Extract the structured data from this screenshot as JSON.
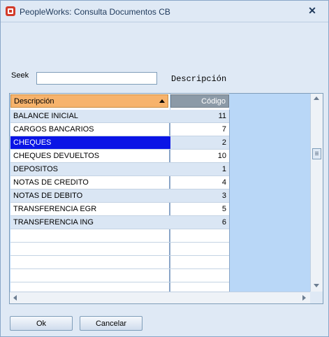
{
  "window": {
    "title": "PeopleWorks: Consulta Documentos CB",
    "close_glyph": "✕"
  },
  "seek": {
    "label": "Seek",
    "value": "",
    "field_caption": "Descripción"
  },
  "grid": {
    "columns": {
      "description": "Descripción",
      "code": "Código"
    },
    "rows": [
      {
        "description": "BALANCE INICIAL",
        "code": "11"
      },
      {
        "description": "CARGOS BANCARIOS",
        "code": "7"
      },
      {
        "description": "CHEQUES",
        "code": "2"
      },
      {
        "description": "CHEQUES DEVUELTOS",
        "code": "10"
      },
      {
        "description": "DEPOSITOS",
        "code": "1"
      },
      {
        "description": "NOTAS DE CREDITO",
        "code": "4"
      },
      {
        "description": "NOTAS DE DEBITO",
        "code": "3"
      },
      {
        "description": "TRANSFERENCIA EGR",
        "code": "5"
      },
      {
        "description": "TRANSFERENCIA ING",
        "code": "6"
      },
      {
        "description": "",
        "code": ""
      },
      {
        "description": "",
        "code": ""
      },
      {
        "description": "",
        "code": ""
      },
      {
        "description": "",
        "code": ""
      },
      {
        "description": "",
        "code": ""
      }
    ],
    "selected_row": "CHEQUES"
  },
  "buttons": {
    "ok": "Ok",
    "cancel": "Cancelar"
  },
  "colors": {
    "selection": "#0a14e6",
    "header_description": "#f7b36c",
    "header_code": "#8c9aa7",
    "grid_background": "#b9d7f7",
    "window_background": "#dfe9f5"
  }
}
